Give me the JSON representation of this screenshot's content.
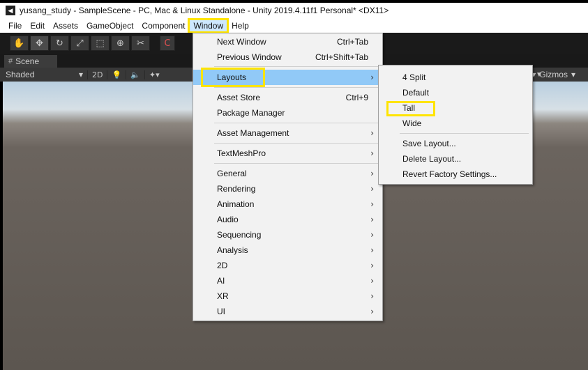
{
  "window": {
    "logo": "◀",
    "title": "yusang_study - SampleScene - PC, Mac & Linux Standalone - Unity 2019.4.11f1 Personal* <DX11>"
  },
  "menubar": {
    "items": [
      "File",
      "Edit",
      "Assets",
      "GameObject",
      "Component",
      "Window",
      "Help"
    ],
    "active": "Window"
  },
  "toolbar": {
    "tools": [
      {
        "icon": "hand-icon",
        "glyph": "✋"
      },
      {
        "icon": "move-icon",
        "glyph": "✥"
      },
      {
        "icon": "rotate-icon",
        "glyph": "↻"
      },
      {
        "icon": "scale-icon",
        "glyph": "⤢"
      },
      {
        "icon": "rect-icon",
        "glyph": "⬚"
      },
      {
        "icon": "transform-icon",
        "glyph": "⊕"
      },
      {
        "icon": "custom-tool-icon",
        "glyph": "✂"
      }
    ],
    "center_label": "C"
  },
  "scene": {
    "tab_label": "Scene",
    "tab_icon": "#",
    "shading_mode": "Shaded",
    "mode_2d": "2D",
    "gizmos_label": "Gizmos"
  },
  "window_menu": {
    "next_window": "Next Window",
    "next_window_sc": "Ctrl+Tab",
    "previous_window": "Previous Window",
    "previous_window_sc": "Ctrl+Shift+Tab",
    "layouts": "Layouts",
    "asset_store": "Asset Store",
    "asset_store_sc": "Ctrl+9",
    "package_manager": "Package Manager",
    "asset_management": "Asset Management",
    "textmeshpro": "TextMeshPro",
    "general": "General",
    "rendering": "Rendering",
    "animation": "Animation",
    "audio": "Audio",
    "sequencing": "Sequencing",
    "analysis": "Analysis",
    "two_d": "2D",
    "ai": "AI",
    "xr": "XR",
    "ui": "UI",
    "arrow": "›"
  },
  "layouts_menu": {
    "four_split": "4 Split",
    "default": "Default",
    "tall": "Tall",
    "wide": "Wide",
    "save_layout": "Save Layout...",
    "delete_layout": "Delete Layout...",
    "revert": "Revert Factory Settings..."
  },
  "colors": {
    "highlight": "#ffe400",
    "selection": "#91c9f7"
  }
}
